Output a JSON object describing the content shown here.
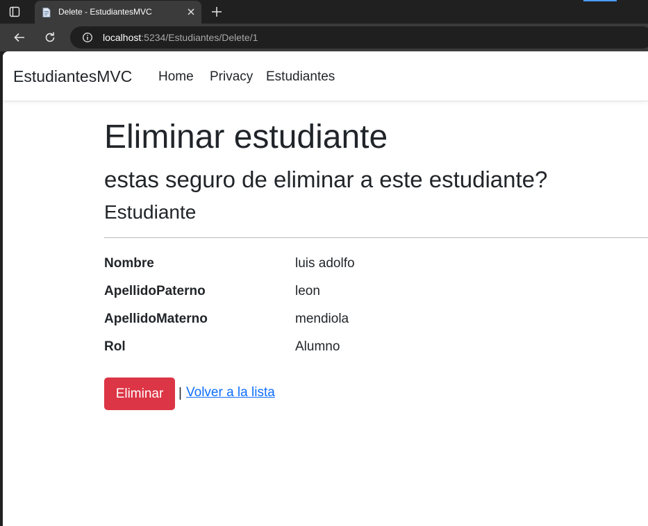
{
  "browser": {
    "tab_title": "Delete - EstudiantesMVC",
    "url_host": "localhost",
    "url_rest": ":5234/Estudiantes/Delete/1",
    "icons": [
      "tab-actions-icon",
      "page-favicon-icon",
      "close-icon",
      "plus-icon",
      "back-arrow-icon",
      "reload-icon",
      "info-icon"
    ]
  },
  "navbar": {
    "brand": "EstudiantesMVC",
    "links": [
      "Home",
      "Privacy",
      "Estudiantes"
    ]
  },
  "page": {
    "title": "Eliminar estudiante",
    "question": "estas seguro de eliminar a este estudiante?",
    "section": "Estudiante",
    "fields": [
      {
        "label": "Nombre",
        "value": "luis adolfo"
      },
      {
        "label": "ApellidoPaterno",
        "value": "leon"
      },
      {
        "label": "ApellidoMaterno",
        "value": "mendiola"
      },
      {
        "label": "Rol",
        "value": "Alumno"
      }
    ],
    "delete_button": "Eliminar",
    "separator": "|",
    "back_link": "Volver a la lista"
  },
  "colors": {
    "danger": "#dc3545",
    "link": "#0d6efd",
    "text": "#212529",
    "browser_frame": "#202020",
    "browser_toolbar": "#3b3b3b"
  }
}
